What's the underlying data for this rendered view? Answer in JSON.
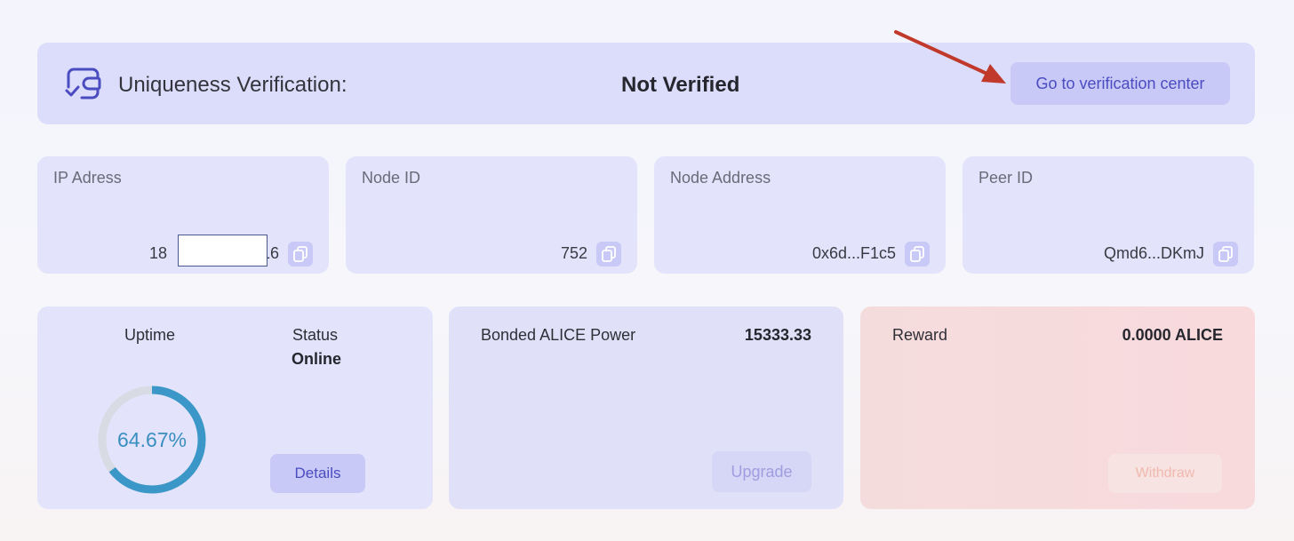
{
  "verification": {
    "label": "Uniqueness Verification:",
    "status": "Not Verified",
    "button_label": "Go to verification center",
    "icon": "wallet-check-icon",
    "arrow_color": "#c0392b"
  },
  "info_cards": [
    {
      "title": "IP Adress",
      "value_prefix": "18",
      "value_suffix": "16",
      "copy_icon": "copy-icon"
    },
    {
      "title": "Node ID",
      "value": "752",
      "copy_icon": "copy-icon"
    },
    {
      "title": "Node Address",
      "value": "0x6d...F1c5",
      "copy_icon": "copy-icon"
    },
    {
      "title": "Peer ID",
      "value": "Qmd6...DKmJ",
      "copy_icon": "copy-icon"
    }
  ],
  "uptime": {
    "label": "Uptime",
    "percent_text": "64.67%",
    "percent_value": 64.67,
    "status_label": "Status",
    "status_value": "Online",
    "details_label": "Details"
  },
  "power": {
    "label": "Bonded ALICE Power",
    "value": "15333.33",
    "upgrade_label": "Upgrade"
  },
  "reward": {
    "label": "Reward",
    "value": "0.0000 ALICE",
    "withdraw_label": "Withdraw"
  },
  "colors": {
    "accent": "#4a4cc0",
    "gauge": "#3a97c7",
    "gauge_track": "#d8dbe3"
  }
}
